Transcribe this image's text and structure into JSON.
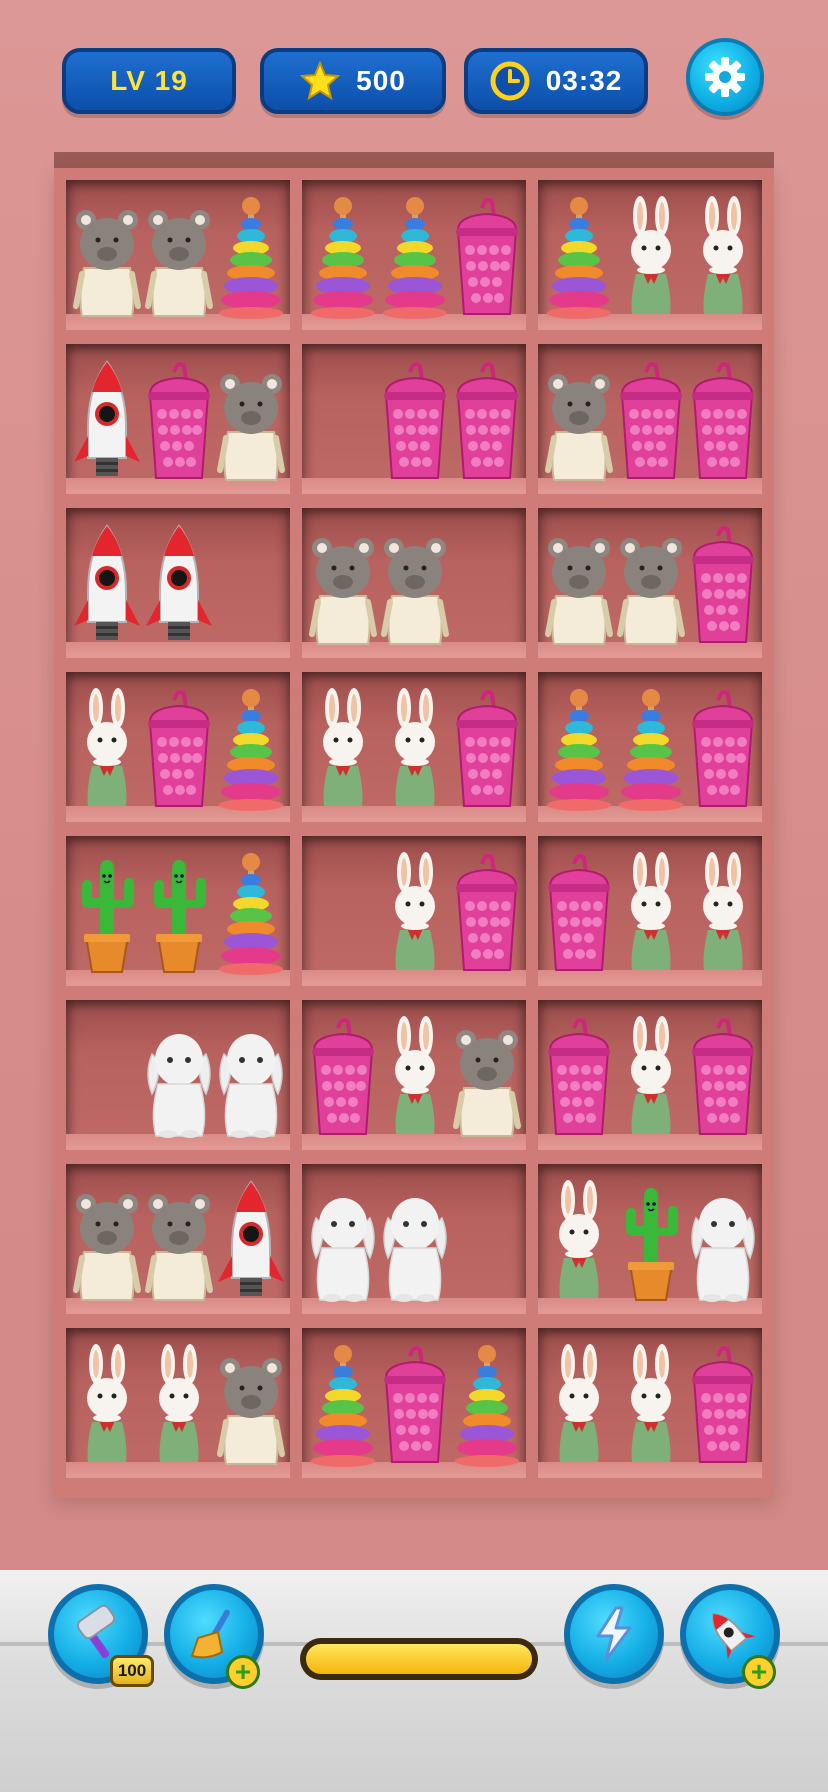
{
  "hud": {
    "level_label": "LV 19",
    "stars": "500",
    "timer": "03:32",
    "settings_icon": "gear-icon",
    "star_icon": "star-icon",
    "clock_icon": "clock-icon"
  },
  "colors": {
    "hud_blue": "#0d4fa9",
    "accent_yellow": "#ffe53b",
    "wall_pink": "#d9918f",
    "shelf_pink": "#cf7c78"
  },
  "shelf": {
    "rows": [
      [
        [
          "mouse",
          "mouse",
          "stacker"
        ],
        [
          "stacker",
          "stacker",
          "popit"
        ],
        [
          "stacker",
          "bunny",
          "bunny"
        ]
      ],
      [
        [
          "rocket",
          "popit",
          "mouse"
        ],
        [
          "",
          "popit",
          "popit"
        ],
        [
          "mouse",
          "popit",
          "popit"
        ]
      ],
      [
        [
          "rocket",
          "rocket",
          ""
        ],
        [
          "mouse",
          "mouse",
          ""
        ],
        [
          "mouse",
          "mouse",
          "popit"
        ]
      ],
      [
        [
          "bunny",
          "popit",
          "stacker"
        ],
        [
          "bunny",
          "bunny",
          "popit"
        ],
        [
          "stacker",
          "stacker",
          "popit"
        ]
      ],
      [
        [
          "cactus",
          "cactus",
          "stacker"
        ],
        [
          "",
          "bunny",
          "popit"
        ],
        [
          "popit",
          "bunny",
          "bunny"
        ]
      ],
      [
        [
          "",
          "rabbit",
          "rabbit"
        ],
        [
          "popit",
          "bunny",
          "mouse"
        ],
        [
          "popit",
          "bunny",
          "popit"
        ]
      ],
      [
        [
          "mouse",
          "mouse",
          "rocket"
        ],
        [
          "rabbit",
          "rabbit",
          ""
        ],
        [
          "bunny",
          "cactus",
          "rabbit"
        ]
      ],
      [
        [
          "bunny",
          "bunny",
          "mouse"
        ],
        [
          "stacker",
          "popit",
          "stacker"
        ],
        [
          "bunny",
          "bunny",
          "popit"
        ]
      ]
    ]
  },
  "boosters": {
    "hammer": {
      "icon": "hammer-icon",
      "count": "100"
    },
    "broom": {
      "icon": "broom-icon"
    },
    "lightning": {
      "icon": "lightning-icon"
    },
    "rocket": {
      "icon": "rocket-icon"
    },
    "plus_label": "+"
  },
  "progress": {
    "value": 1.0
  }
}
